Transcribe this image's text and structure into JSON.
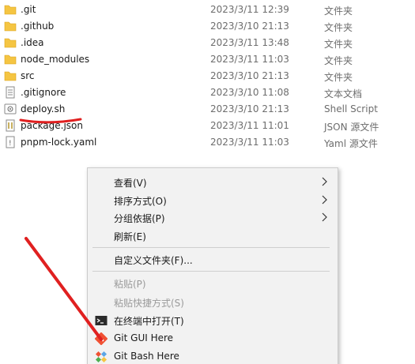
{
  "files": [
    {
      "name": ".git",
      "date": "2023/3/11 12:39",
      "type": "文件夹",
      "icon": "folder-icon"
    },
    {
      "name": ".github",
      "date": "2023/3/10 21:13",
      "type": "文件夹",
      "icon": "folder-icon"
    },
    {
      "name": ".idea",
      "date": "2023/3/11 13:48",
      "type": "文件夹",
      "icon": "folder-icon"
    },
    {
      "name": "node_modules",
      "date": "2023/3/11 11:03",
      "type": "文件夹",
      "icon": "folder-icon"
    },
    {
      "name": "src",
      "date": "2023/3/10 21:13",
      "type": "文件夹",
      "icon": "folder-icon"
    },
    {
      "name": ".gitignore",
      "date": "2023/3/10 11:08",
      "type": "文本文档",
      "icon": "text-file-icon"
    },
    {
      "name": "deploy.sh",
      "date": "2023/3/10 21:13",
      "type": "Shell Script",
      "icon": "shell-script-icon"
    },
    {
      "name": "package.json",
      "date": "2023/3/11 11:01",
      "type": "JSON 源文件",
      "icon": "json-file-icon"
    },
    {
      "name": "pnpm-lock.yaml",
      "date": "2023/3/11 11:03",
      "type": "Yaml 源文件",
      "icon": "yaml-file-icon"
    }
  ],
  "context_menu": {
    "view": "查看(V)",
    "sort": "排序方式(O)",
    "group": "分组依据(P)",
    "refresh": "刷新(E)",
    "customize": "自定义文件夹(F)...",
    "paste": "粘贴(P)",
    "paste_shortcut": "粘贴快捷方式(S)",
    "open_terminal": "在终端中打开(T)",
    "git_gui": "Git GUI Here",
    "git_bash": "Git Bash Here"
  },
  "colors": {
    "annotation": "#e02020",
    "folder": "#f5c542",
    "menu_bg": "#f2f2f2"
  }
}
